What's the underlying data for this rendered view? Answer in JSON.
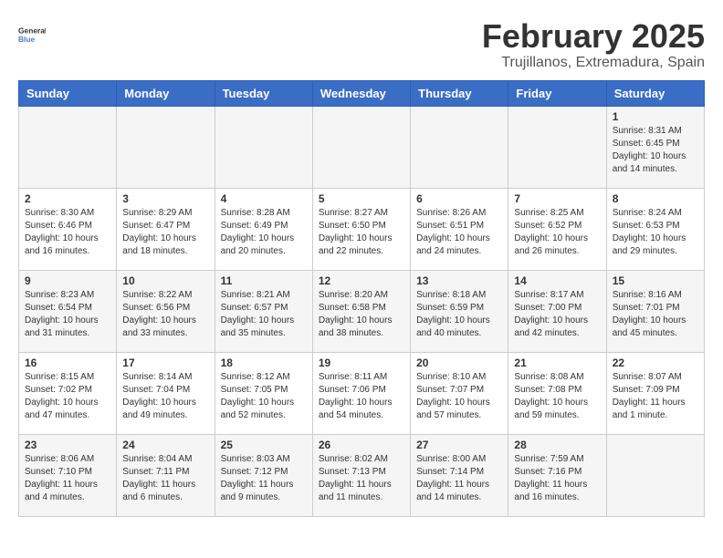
{
  "logo": {
    "general": "General",
    "blue": "Blue"
  },
  "title": "February 2025",
  "subtitle": "Trujillanos, Extremadura, Spain",
  "days_of_week": [
    "Sunday",
    "Monday",
    "Tuesday",
    "Wednesday",
    "Thursday",
    "Friday",
    "Saturday"
  ],
  "weeks": [
    [
      {
        "day": "",
        "info": ""
      },
      {
        "day": "",
        "info": ""
      },
      {
        "day": "",
        "info": ""
      },
      {
        "day": "",
        "info": ""
      },
      {
        "day": "",
        "info": ""
      },
      {
        "day": "",
        "info": ""
      },
      {
        "day": "1",
        "info": "Sunrise: 8:31 AM\nSunset: 6:45 PM\nDaylight: 10 hours and 14 minutes."
      }
    ],
    [
      {
        "day": "2",
        "info": "Sunrise: 8:30 AM\nSunset: 6:46 PM\nDaylight: 10 hours and 16 minutes."
      },
      {
        "day": "3",
        "info": "Sunrise: 8:29 AM\nSunset: 6:47 PM\nDaylight: 10 hours and 18 minutes."
      },
      {
        "day": "4",
        "info": "Sunrise: 8:28 AM\nSunset: 6:49 PM\nDaylight: 10 hours and 20 minutes."
      },
      {
        "day": "5",
        "info": "Sunrise: 8:27 AM\nSunset: 6:50 PM\nDaylight: 10 hours and 22 minutes."
      },
      {
        "day": "6",
        "info": "Sunrise: 8:26 AM\nSunset: 6:51 PM\nDaylight: 10 hours and 24 minutes."
      },
      {
        "day": "7",
        "info": "Sunrise: 8:25 AM\nSunset: 6:52 PM\nDaylight: 10 hours and 26 minutes."
      },
      {
        "day": "8",
        "info": "Sunrise: 8:24 AM\nSunset: 6:53 PM\nDaylight: 10 hours and 29 minutes."
      }
    ],
    [
      {
        "day": "9",
        "info": "Sunrise: 8:23 AM\nSunset: 6:54 PM\nDaylight: 10 hours and 31 minutes."
      },
      {
        "day": "10",
        "info": "Sunrise: 8:22 AM\nSunset: 6:56 PM\nDaylight: 10 hours and 33 minutes."
      },
      {
        "day": "11",
        "info": "Sunrise: 8:21 AM\nSunset: 6:57 PM\nDaylight: 10 hours and 35 minutes."
      },
      {
        "day": "12",
        "info": "Sunrise: 8:20 AM\nSunset: 6:58 PM\nDaylight: 10 hours and 38 minutes."
      },
      {
        "day": "13",
        "info": "Sunrise: 8:18 AM\nSunset: 6:59 PM\nDaylight: 10 hours and 40 minutes."
      },
      {
        "day": "14",
        "info": "Sunrise: 8:17 AM\nSunset: 7:00 PM\nDaylight: 10 hours and 42 minutes."
      },
      {
        "day": "15",
        "info": "Sunrise: 8:16 AM\nSunset: 7:01 PM\nDaylight: 10 hours and 45 minutes."
      }
    ],
    [
      {
        "day": "16",
        "info": "Sunrise: 8:15 AM\nSunset: 7:02 PM\nDaylight: 10 hours and 47 minutes."
      },
      {
        "day": "17",
        "info": "Sunrise: 8:14 AM\nSunset: 7:04 PM\nDaylight: 10 hours and 49 minutes."
      },
      {
        "day": "18",
        "info": "Sunrise: 8:12 AM\nSunset: 7:05 PM\nDaylight: 10 hours and 52 minutes."
      },
      {
        "day": "19",
        "info": "Sunrise: 8:11 AM\nSunset: 7:06 PM\nDaylight: 10 hours and 54 minutes."
      },
      {
        "day": "20",
        "info": "Sunrise: 8:10 AM\nSunset: 7:07 PM\nDaylight: 10 hours and 57 minutes."
      },
      {
        "day": "21",
        "info": "Sunrise: 8:08 AM\nSunset: 7:08 PM\nDaylight: 10 hours and 59 minutes."
      },
      {
        "day": "22",
        "info": "Sunrise: 8:07 AM\nSunset: 7:09 PM\nDaylight: 11 hours and 1 minute."
      }
    ],
    [
      {
        "day": "23",
        "info": "Sunrise: 8:06 AM\nSunset: 7:10 PM\nDaylight: 11 hours and 4 minutes."
      },
      {
        "day": "24",
        "info": "Sunrise: 8:04 AM\nSunset: 7:11 PM\nDaylight: 11 hours and 6 minutes."
      },
      {
        "day": "25",
        "info": "Sunrise: 8:03 AM\nSunset: 7:12 PM\nDaylight: 11 hours and 9 minutes."
      },
      {
        "day": "26",
        "info": "Sunrise: 8:02 AM\nSunset: 7:13 PM\nDaylight: 11 hours and 11 minutes."
      },
      {
        "day": "27",
        "info": "Sunrise: 8:00 AM\nSunset: 7:14 PM\nDaylight: 11 hours and 14 minutes."
      },
      {
        "day": "28",
        "info": "Sunrise: 7:59 AM\nSunset: 7:16 PM\nDaylight: 11 hours and 16 minutes."
      },
      {
        "day": "",
        "info": ""
      }
    ]
  ]
}
